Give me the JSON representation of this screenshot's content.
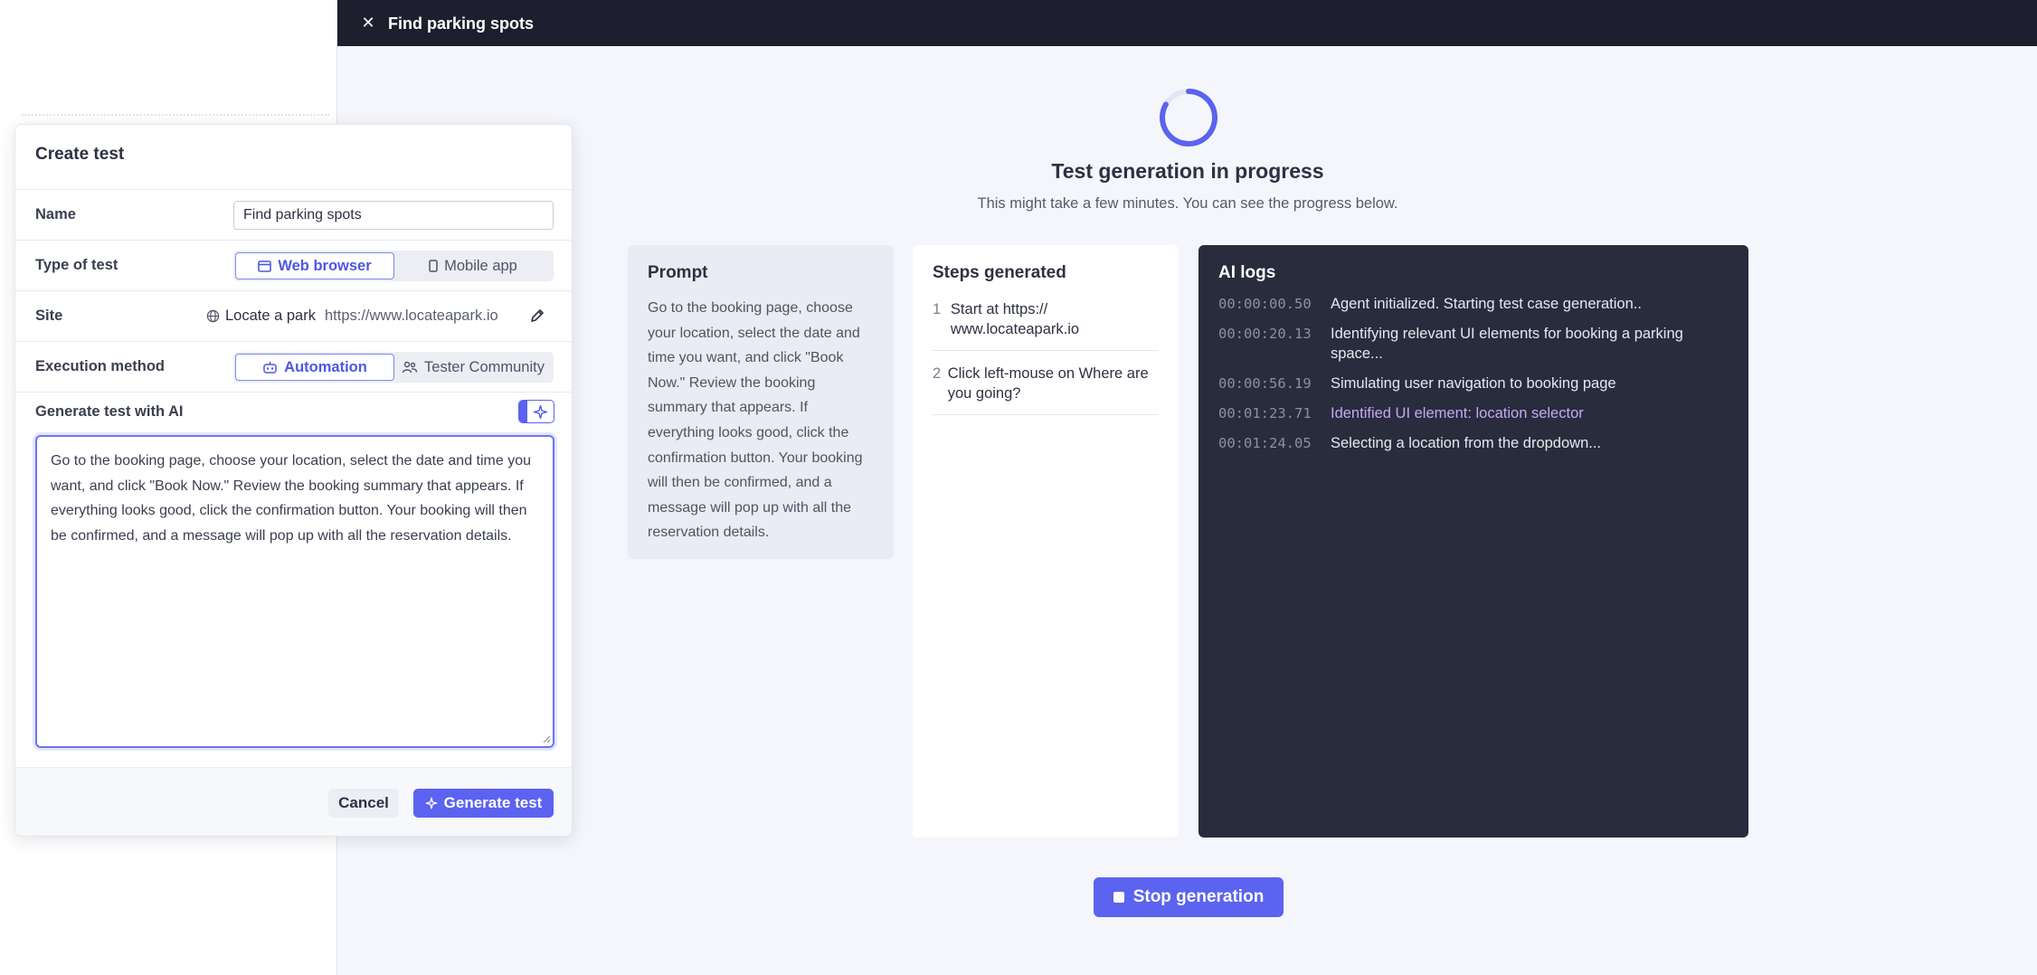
{
  "header": {
    "title": "Find parking spots",
    "close_icon": "close-icon"
  },
  "status": {
    "heading": "Test generation in progress",
    "subtext": "This might take a few minutes. You can see the progress below."
  },
  "prompt_panel": {
    "title": "Prompt",
    "text": "Go to the booking page, choose your location, select the date and time you want, and click \"Book Now.\" Review the booking summary that appears. If everything looks good, click the confirmation button. Your booking will then be confirmed, and a message will pop up with all the reservation details."
  },
  "steps_panel": {
    "title": "Steps generated",
    "steps": [
      {
        "num": "1",
        "text": "Start at https:// www.locateapark.io"
      },
      {
        "num": "2",
        "text": "Click left-mouse on Where are you going?"
      }
    ]
  },
  "logs_panel": {
    "title": "AI logs",
    "logs": [
      {
        "time": "00:00:00.50",
        "msg": "Agent initialized. Starting test case generation..",
        "highlight": false
      },
      {
        "time": "00:00:20.13",
        "msg": "Identifying relevant UI elements for booking a parking space...",
        "highlight": false
      },
      {
        "time": "00:00:56.19",
        "msg": "Simulating user navigation to booking page",
        "highlight": false
      },
      {
        "time": "00:01:23.71",
        "msg": "Identified UI element: location selector",
        "highlight": true
      },
      {
        "time": "00:01:24.05",
        "msg": "Selecting a location from the dropdown...",
        "highlight": false
      }
    ],
    "highlight_color": "#c7a6f5"
  },
  "stop_button": {
    "label": "Stop generation"
  },
  "modal": {
    "title": "Create test",
    "name_label": "Name",
    "name_value": "Find parking spots",
    "type_label": "Type of test",
    "type_options": [
      "Web browser",
      "Mobile app"
    ],
    "type_selected": "Web browser",
    "site_label": "Site",
    "site_name": "Locate a park",
    "site_url": "https://www.locateapark.io",
    "exec_label": "Execution method",
    "exec_options": [
      "Automation",
      "Tester Community"
    ],
    "exec_selected": "Automation",
    "ai_label": "Generate test with AI",
    "ai_enabled": true,
    "prompt_value": "Go to the booking page, choose your location, select the date and time you want, and click \"Book Now.\" Review the booking summary that appears. If everything looks good, click the confirmation button. Your booking will then be confirmed, and a message will pop up with all the reservation details.",
    "cancel_label": "Cancel",
    "generate_label": "Generate test"
  },
  "colors": {
    "accent": "#5b63f0",
    "topbar": "#1d1f2e",
    "logs_bg": "#282c3c"
  }
}
